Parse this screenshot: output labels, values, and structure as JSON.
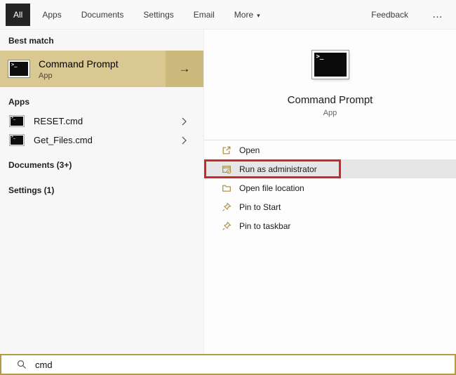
{
  "colors": {
    "accent_tan": "#d9c892",
    "accent_tan_dark": "#ccb97c",
    "active_tab_bg": "#242424",
    "highlight_red": "#ce2727",
    "search_border_gold": "#b59b43",
    "action_icon_gold": "#a98b3f",
    "selected_row_gray": "#e6e6e6"
  },
  "topbar": {
    "tabs": [
      {
        "label": "All"
      },
      {
        "label": "Apps"
      },
      {
        "label": "Documents"
      },
      {
        "label": "Settings"
      },
      {
        "label": "Email"
      },
      {
        "label": "More"
      }
    ],
    "more_chevron": "▾",
    "feedback_label": "Feedback",
    "ellipsis": "…"
  },
  "left_panel": {
    "best_match_header": "Best match",
    "best_match": {
      "title": "Command Prompt",
      "subtitle": "App",
      "arrow": "→"
    },
    "apps_header": "Apps",
    "app_items": [
      {
        "label": "RESET.cmd"
      },
      {
        "label": "Get_Files.cmd"
      }
    ],
    "documents_header": "Documents (3+)",
    "settings_header": "Settings (1)"
  },
  "right_panel": {
    "title": "Command Prompt",
    "subtitle": "App",
    "actions": [
      {
        "label": "Open"
      },
      {
        "label": "Run as administrator",
        "highlighted": true
      },
      {
        "label": "Open file location"
      },
      {
        "label": "Pin to Start"
      },
      {
        "label": "Pin to taskbar"
      }
    ]
  },
  "search_bar": {
    "value": "cmd"
  }
}
